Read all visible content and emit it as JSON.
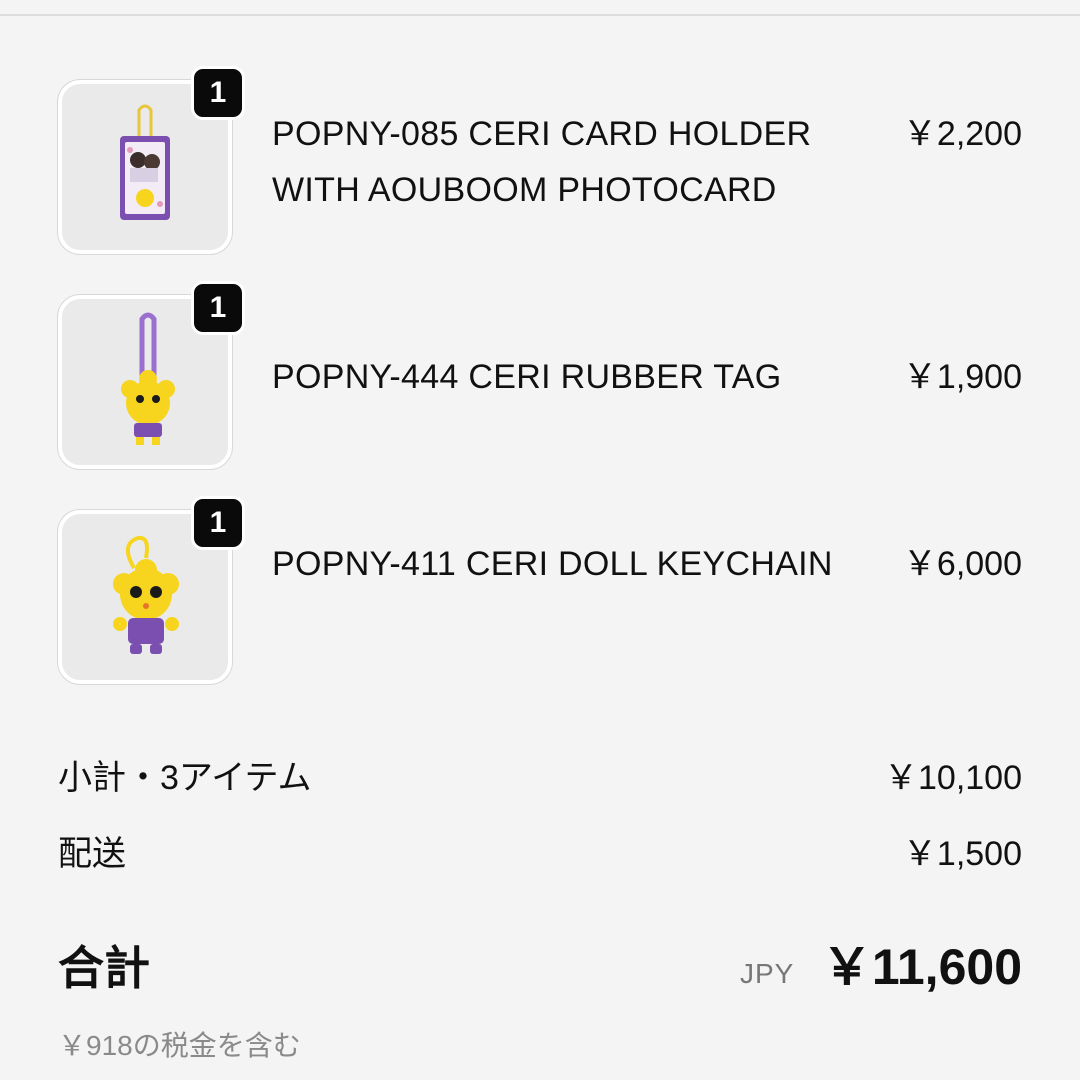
{
  "items": [
    {
      "quantity": "1",
      "name": "POPNY-085 CERI CARD HOLDER WITH AOUBOOM PHOTOCARD",
      "price": "￥2,200",
      "thumbnail_icon": "card-holder-icon"
    },
    {
      "quantity": "1",
      "name": "POPNY-444 CERI RUBBER TAG",
      "price": "￥1,900",
      "thumbnail_icon": "rubber-tag-icon"
    },
    {
      "quantity": "1",
      "name": "POPNY-411 CERI DOLL KEYCHAIN",
      "price": "￥6,000",
      "thumbnail_icon": "doll-keychain-icon"
    }
  ],
  "summary": {
    "subtotal_label": "小計・3アイテム",
    "subtotal_value": "￥10,100",
    "shipping_label": "配送",
    "shipping_value": "￥1,500"
  },
  "total": {
    "label": "合計",
    "currency": "JPY",
    "value": "￥11,600",
    "tax_note": "￥918の税金を含む"
  },
  "colors": {
    "background": "#f4f4f4",
    "badge": "#0a0a0a",
    "product_yellow": "#f7d51f",
    "product_purple": "#7b4fb0"
  }
}
